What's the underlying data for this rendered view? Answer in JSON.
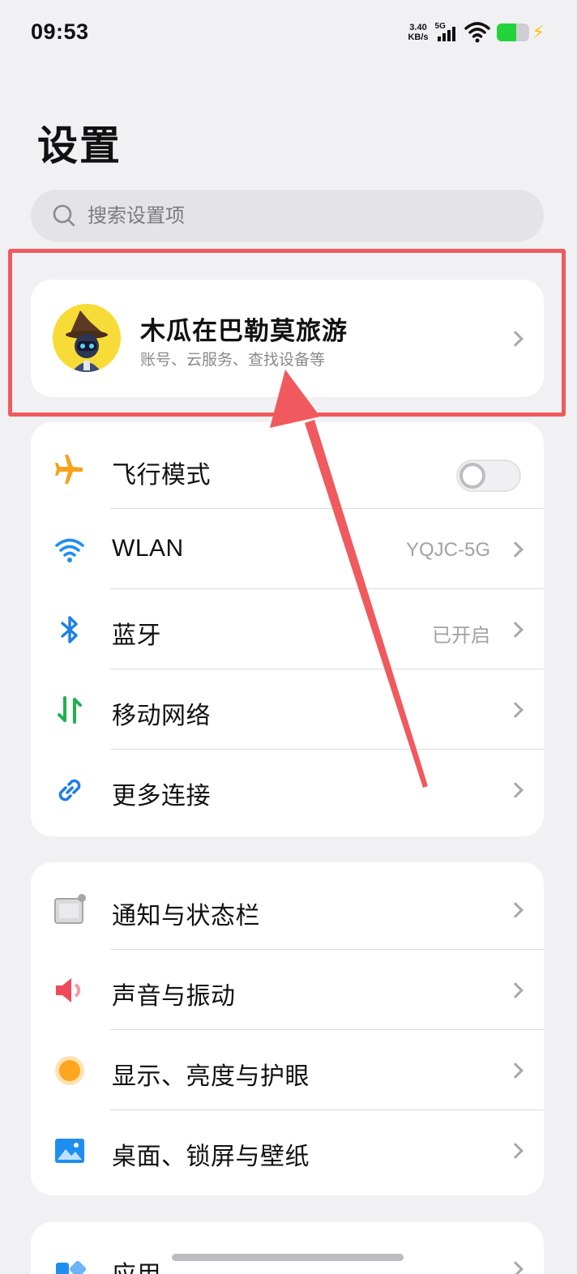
{
  "status_bar": {
    "time": "09:53",
    "net_speed_value": "3.40",
    "net_speed_unit": "KB/s",
    "network_type": "5G",
    "battery_level_percent": 60,
    "charging": true
  },
  "page": {
    "title": "设置"
  },
  "search": {
    "placeholder": "搜索设置项"
  },
  "account": {
    "name": "木瓜在巴勒莫旅游",
    "subtitle": "账号、云服务、查找设备等"
  },
  "connectivity": [
    {
      "label": "飞行模式",
      "icon": "airplane-icon",
      "type": "toggle",
      "on": false
    },
    {
      "label": "WLAN",
      "icon": "wifi-icon",
      "value": "YQJC-5G"
    },
    {
      "label": "蓝牙",
      "icon": "bluetooth-icon",
      "value": "已开启"
    },
    {
      "label": "移动网络",
      "icon": "mobile-network-icon"
    },
    {
      "label": "更多连接",
      "icon": "link-icon"
    }
  ],
  "personalization": [
    {
      "label": "通知与状态栏",
      "icon": "notification-icon"
    },
    {
      "label": "声音与振动",
      "icon": "speaker-icon"
    },
    {
      "label": "显示、亮度与护眼",
      "icon": "brightness-icon"
    },
    {
      "label": "桌面、锁屏与壁纸",
      "icon": "wallpaper-icon"
    }
  ],
  "apps": [
    {
      "label": "应用",
      "icon": "apps-icon"
    }
  ],
  "colors": {
    "annotation_red": "#f05a5e",
    "airplane": "#f7a11a",
    "wifi": "#1f8ef1",
    "bluetooth": "#1e7fe6",
    "mobile_down": "#1fb14f",
    "mobile_up": "#1fb14f",
    "sound": "#ef4a5a",
    "brightness": "#ffa51f"
  }
}
